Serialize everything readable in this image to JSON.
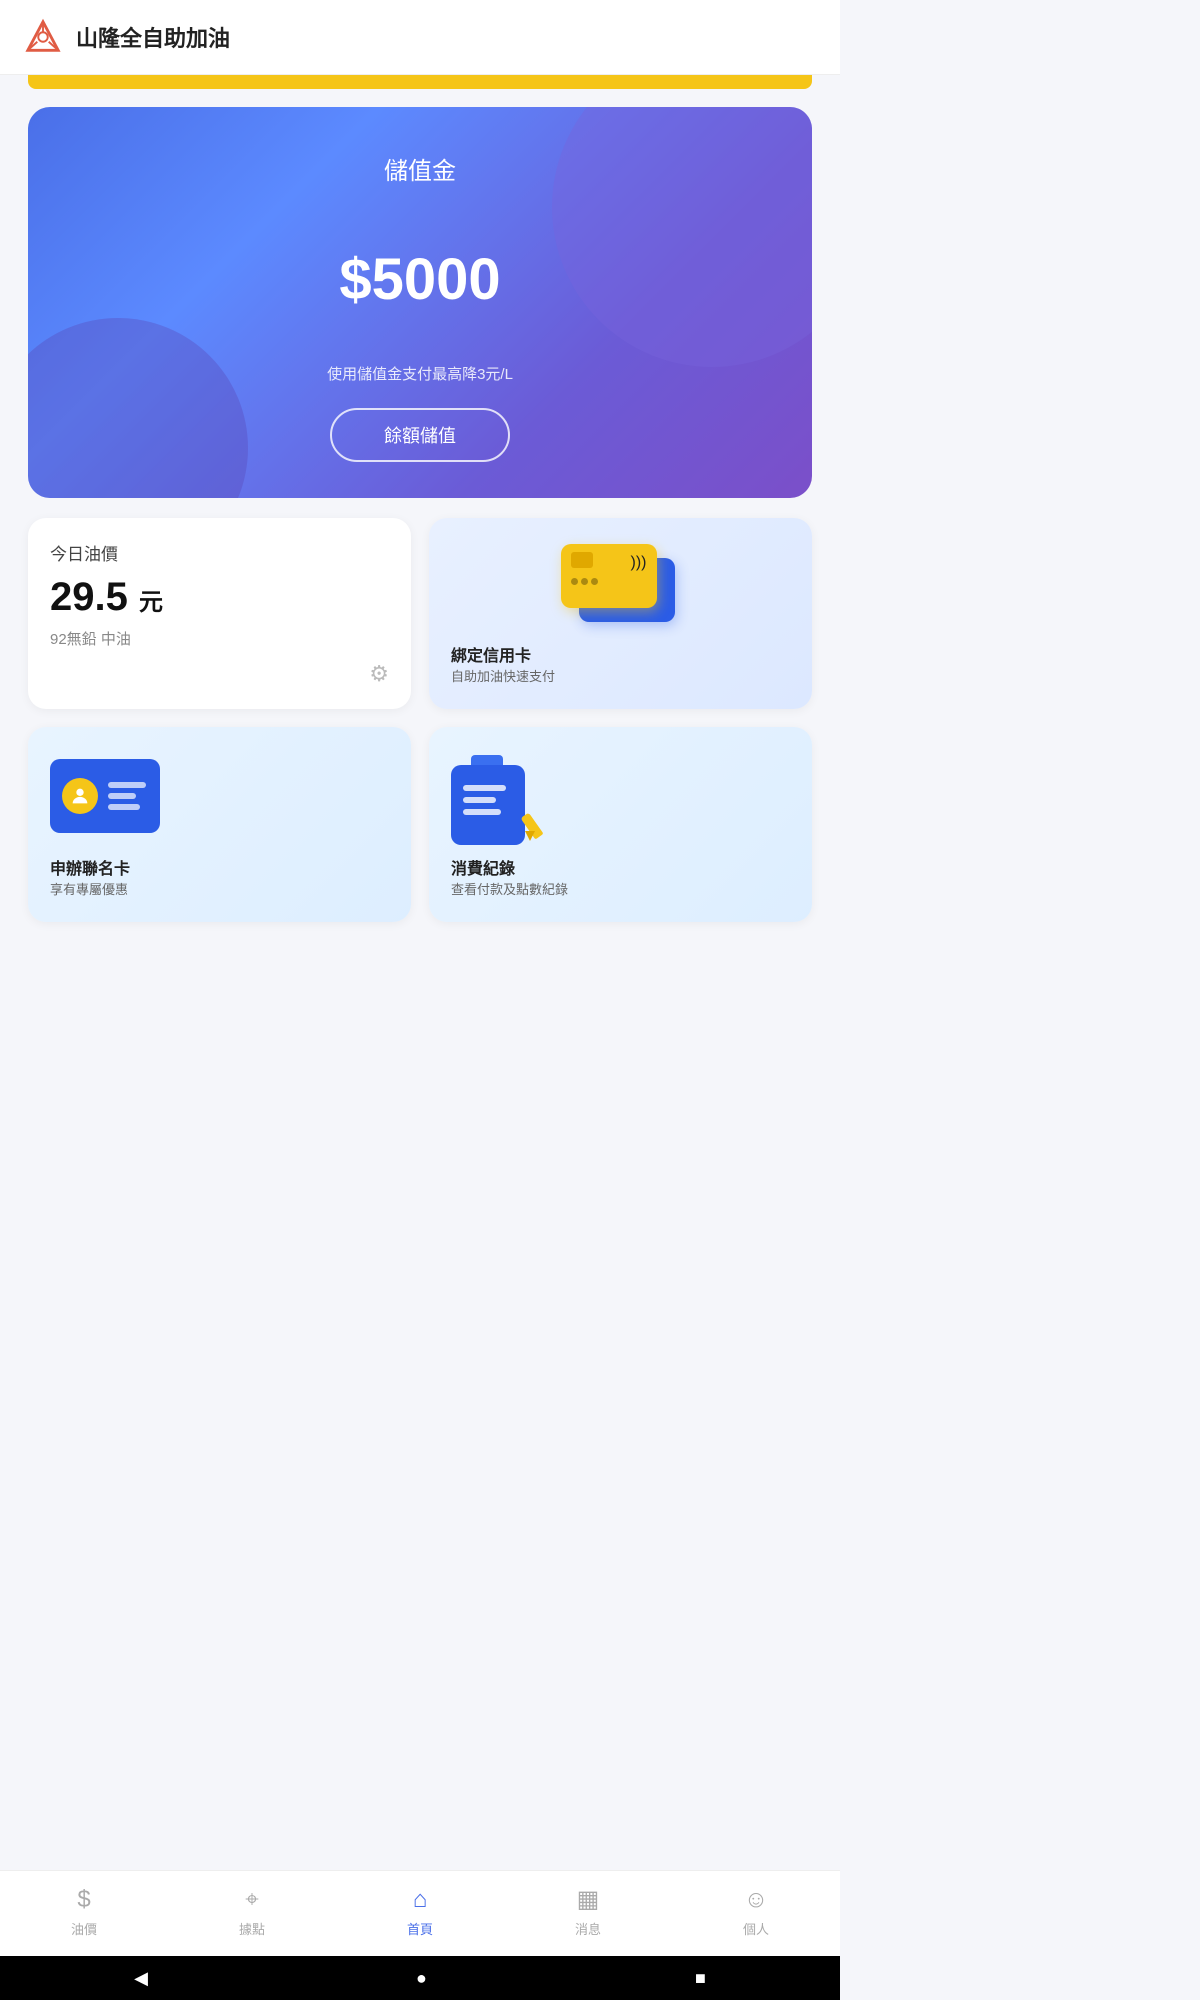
{
  "app": {
    "title": "山隆全自助加油"
  },
  "balance_card": {
    "label": "儲值金",
    "amount": "$5000",
    "hint": "使用儲值金支付最高降3元/L",
    "button": "餘額儲值"
  },
  "oil_price": {
    "label": "今日油價",
    "value": "29.5",
    "unit": "元",
    "sub": "92無鉛 中油"
  },
  "credit_card": {
    "title": "綁定信用卡",
    "sub": "自助加油快速支付"
  },
  "member_card": {
    "title": "申辦聯名卡",
    "sub": "享有專屬優惠"
  },
  "records": {
    "title": "消費紀錄",
    "sub": "查看付款及點數紀錄"
  },
  "bottom_nav": {
    "items": [
      {
        "icon": "💲",
        "label": "油價",
        "active": false
      },
      {
        "icon": "📍",
        "label": "據點",
        "active": false
      },
      {
        "icon": "🏠",
        "label": "首頁",
        "active": true
      },
      {
        "icon": "💬",
        "label": "消息",
        "active": false
      },
      {
        "icon": "👤",
        "label": "個人",
        "active": false
      }
    ]
  }
}
